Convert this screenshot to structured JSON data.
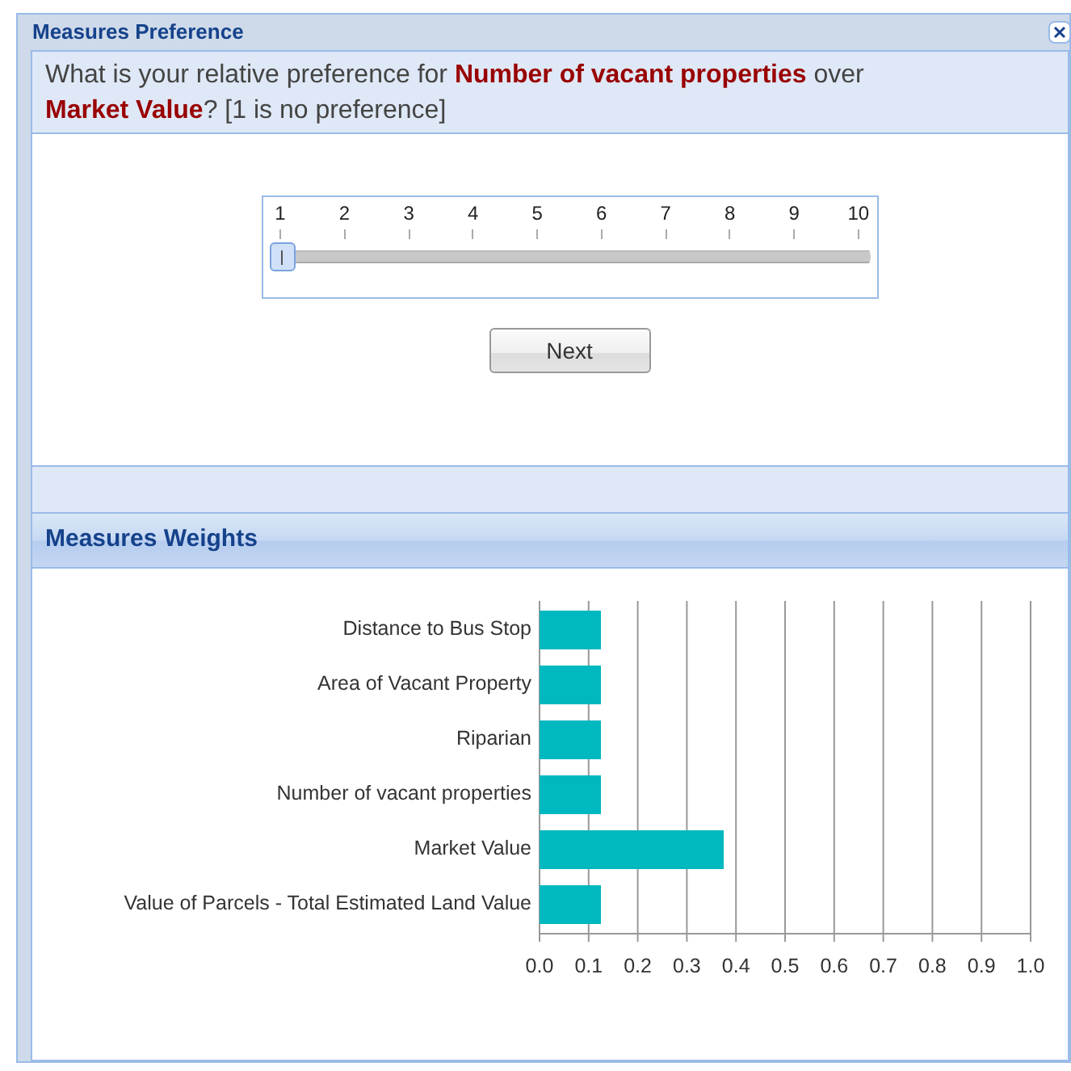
{
  "window": {
    "title": "Measures Preference"
  },
  "question": "What is your relative preference for **Number of vacant properties** over **Market Value**? [1 is no preference]",
  "slider": {
    "ticks": [
      "1",
      "2",
      "3",
      "4",
      "5",
      "6",
      "7",
      "8",
      "9",
      "10"
    ]
  },
  "buttons": [
    "Next"
  ],
  "weights_panel": {
    "title": "Measures Weights",
    "chart_data": {
      "type": "bar",
      "orientation": "horizontal",
      "categories": [
        "Distance to Bus Stop",
        "Area of Vacant Property",
        "Riparian",
        "Number of vacant properties",
        "Market Value",
        "Value of Parcels - Total Estimated Land Value"
      ],
      "grid": true,
      "series": [
        {
          "color": "#00b8c0",
          "values": [
            0.125,
            0.125,
            0.125,
            0.125,
            0.375,
            0.125
          ]
        }
      ],
      "xlim": [
        0,
        1
      ],
      "xticks": [
        {
          "value": 0,
          "label": "0.0"
        },
        {
          "value": 0.1,
          "label": "0.1"
        },
        {
          "value": 0.2,
          "label": "0.2"
        },
        {
          "value": 0.3,
          "label": "0.3"
        },
        {
          "value": 0.4,
          "label": "0.4"
        },
        {
          "value": 0.5,
          "label": "0.5"
        },
        {
          "value": 0.6,
          "label": "0.6"
        },
        {
          "value": 0.7,
          "label": "0.7"
        },
        {
          "value": 0.8,
          "label": "0.8"
        },
        {
          "value": 0.9,
          "label": "0.9"
        },
        {
          "value": 1,
          "label": "1.0"
        }
      ]
    }
  }
}
